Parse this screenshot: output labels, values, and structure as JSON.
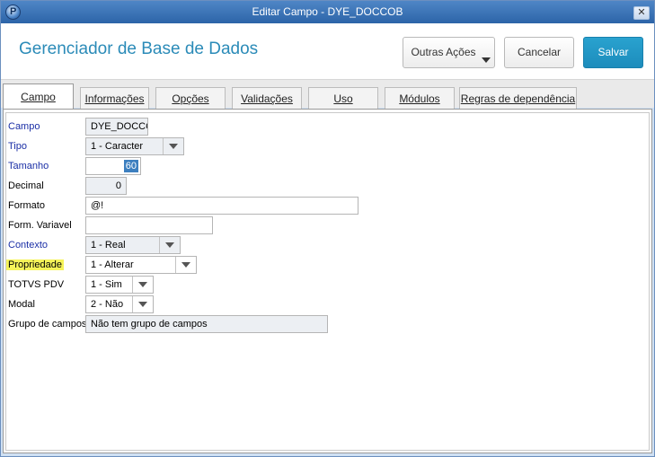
{
  "window": {
    "title": "Editar Campo - DYE_DOCCOB",
    "close_glyph": "✕",
    "icon_glyph": "P"
  },
  "header": {
    "title": "Gerenciador de Base de Dados",
    "outras_label": "Outras Ações",
    "cancel_label": "Cancelar",
    "save_label": "Salvar"
  },
  "tabs": [
    {
      "label": "Campo",
      "active": true
    },
    {
      "label": "Informações"
    },
    {
      "label": "Opções"
    },
    {
      "label": "Validações"
    },
    {
      "label": "Uso"
    },
    {
      "label": "Módulos"
    },
    {
      "label": "Regras de dependência"
    }
  ],
  "form": {
    "campo": {
      "label": "Campo",
      "value": "DYE_DOCCC"
    },
    "tipo": {
      "label": "Tipo",
      "value": "1 - Caracter"
    },
    "tamanho": {
      "label": "Tamanho",
      "value": "60"
    },
    "decimal": {
      "label": "Decimal",
      "value": "0"
    },
    "formato": {
      "label": "Formato",
      "value": "@!"
    },
    "form_variavel": {
      "label": "Form. Variavel",
      "value": ""
    },
    "contexto": {
      "label": "Contexto",
      "value": "1 - Real"
    },
    "propriedade": {
      "label": "Propriedade",
      "value": "1 - Alterar"
    },
    "totvs_pdv": {
      "label": "TOTVS PDV",
      "value": "1 - Sim"
    },
    "modal": {
      "label": "Modal",
      "value": "2 - Não"
    },
    "grupo_campos": {
      "label": "Grupo de campos",
      "value": "Não tem grupo de campos"
    }
  },
  "colors": {
    "accent": "#2b8bb8",
    "save_button": "#1d8cbc",
    "required_label": "#1b2fa6",
    "highlight": "#f6f45a",
    "titlebar": "#2c64a8"
  }
}
